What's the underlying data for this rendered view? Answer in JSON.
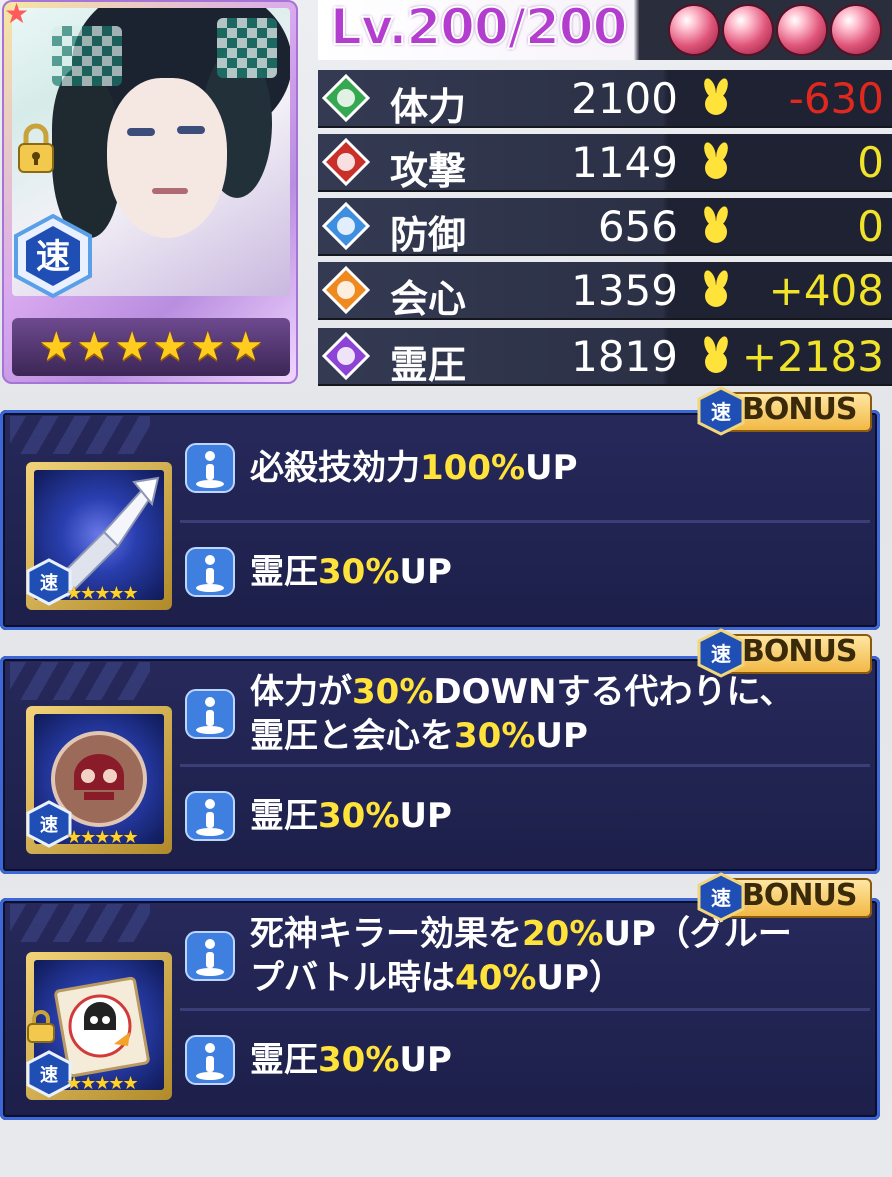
{
  "card": {
    "rarity_stars": [
      "★",
      "★",
      "★",
      "★",
      "★",
      "★"
    ],
    "attribute_label": "速",
    "locked": true
  },
  "level": {
    "text": "Lv.200/200",
    "orbs_filled": 4
  },
  "stats": [
    {
      "key": "hp",
      "name": "体力",
      "value": "2100",
      "bonus": "-630",
      "bonus_color": "#e0281e",
      "icon_color": "#35a852"
    },
    {
      "key": "atk",
      "name": "攻撃",
      "value": "1149",
      "bonus": "0",
      "bonus_color": "#f0e32a",
      "icon_color": "#c9302a"
    },
    {
      "key": "def",
      "name": "防御",
      "value": "656",
      "bonus": "0",
      "bonus_color": "#f0e32a",
      "icon_color": "#3e8fe0"
    },
    {
      "key": "crit",
      "name": "会心",
      "value": "1359",
      "bonus": "+408",
      "bonus_color": "#f0e32a",
      "icon_color": "#ef8a21"
    },
    {
      "key": "sp",
      "name": "霊圧",
      "value": "1819",
      "bonus": "+2183",
      "bonus_color": "#f0e32a",
      "icon_color": "#8d44d6"
    }
  ],
  "bonus_tag": {
    "badge": "速",
    "label": "BONUS"
  },
  "panels": [
    {
      "thumb_label": "速",
      "thumb_stars": "★★★★★",
      "skill1_plain_a": "必殺技効力",
      "skill1_hl": "100%",
      "skill1_plain_b": "UP",
      "skill2_plain_a": "霊圧",
      "skill2_hl": "30%",
      "skill2_plain_b": "UP"
    },
    {
      "thumb_label": "速",
      "thumb_stars": "★★★★★",
      "skill1_line1_a": "体力が",
      "skill1_line1_hl": "30%",
      "skill1_line1_b": "DOWNする代わりに、",
      "skill1_line2_a": "霊圧と会心を",
      "skill1_line2_hl": "30%",
      "skill1_line2_b": "UP",
      "skill2_plain_a": "霊圧",
      "skill2_hl": "30%",
      "skill2_plain_b": "UP"
    },
    {
      "thumb_label": "速",
      "thumb_stars": "★★★★★",
      "skill1_line1_a": "死神キラー効果を",
      "skill1_line1_hl": "20%",
      "skill1_line1_b": "UP（グルー",
      "skill1_line2_a": "プバトル時は",
      "skill1_line2_hl": "40%",
      "skill1_line2_b": "UP）",
      "skill2_plain_a": "霊圧",
      "skill2_hl": "30%",
      "skill2_plain_b": "UP"
    }
  ]
}
